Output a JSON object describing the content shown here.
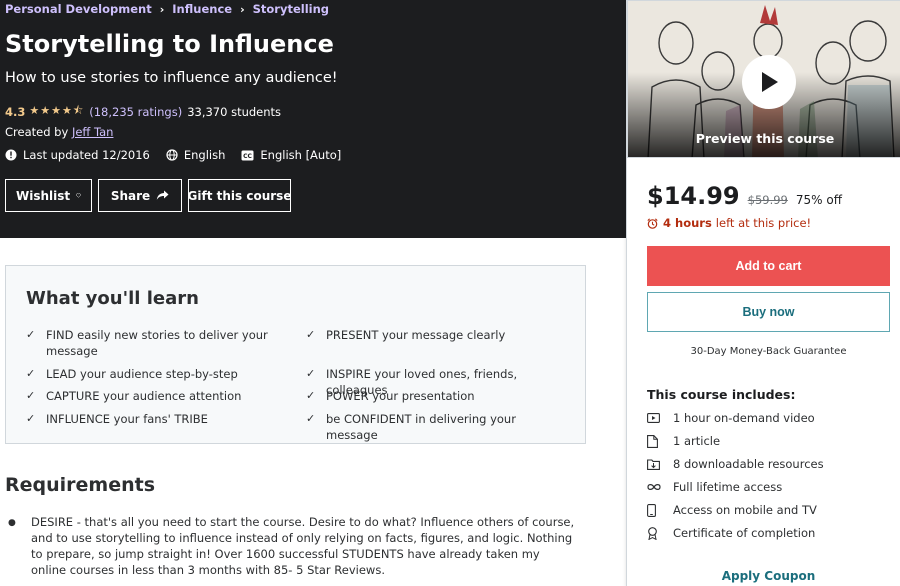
{
  "breadcrumb": [
    "Personal Development",
    "Influence",
    "Storytelling"
  ],
  "course": {
    "title": "Storytelling to Influence",
    "subtitle": "How to use stories to influence any audience!",
    "rating": "4.3",
    "rating_value": 4.3,
    "ratings_count": "(18,235 ratings)",
    "students": "33,370 students",
    "created_by_label": "Created by",
    "instructor": "Jeff Tan",
    "last_updated": "Last updated 12/2016",
    "language": "English",
    "captions": "English [Auto]"
  },
  "buttons": {
    "wishlist": "Wishlist",
    "share": "Share",
    "gift": "Gift this course"
  },
  "learn": {
    "title": "What you'll learn",
    "items": [
      "FIND easily new stories to deliver your message",
      "PRESENT your message clearly",
      "LEAD your audience step-by-step",
      "INSPIRE your loved ones, friends, colleagues",
      "CAPTURE your audience attention",
      "POWER your presentation",
      "INFLUENCE your fans' TRIBE",
      "be CONFIDENT in delivering your message"
    ]
  },
  "requirements": {
    "title": "Requirements",
    "items": [
      "DESIRE - that's all you need to start the course. Desire to do what? Influence others of course, and to use storytelling to influence instead of only relying on facts, figures, and logic. Nothing to prepare, so jump straight in! Over 1600 successful STUDENTS have already taken my online courses in less than 3 months with 85- 5 Star Reviews."
    ]
  },
  "sidebar": {
    "preview_label": "Preview this course",
    "price": "$14.99",
    "original_price": "$59.99",
    "discount": "75% off",
    "time_left_bold": "4 hours",
    "time_left_rest": "left at this price!",
    "add_to_cart": "Add to cart",
    "buy_now": "Buy now",
    "guarantee": "30-Day Money-Back Guarantee",
    "includes_title": "This course includes:",
    "includes": [
      {
        "icon": "video-icon",
        "label": "1 hour on-demand video"
      },
      {
        "icon": "file-icon",
        "label": "1 article"
      },
      {
        "icon": "download-folder-icon",
        "label": "8 downloadable resources"
      },
      {
        "icon": "infinity-icon",
        "label": "Full lifetime access"
      },
      {
        "icon": "mobile-icon",
        "label": "Access on mobile and TV"
      },
      {
        "icon": "certificate-icon",
        "label": "Certificate of completion"
      }
    ],
    "apply_coupon": "Apply Coupon"
  },
  "colors": {
    "hero_bg": "#1c1d1f",
    "accent_purple": "#cec0fc",
    "star": "#f3ca8c",
    "cart_red": "#ec5252",
    "urgent_red": "#b32d0f",
    "teal": "#1b6e7d"
  }
}
